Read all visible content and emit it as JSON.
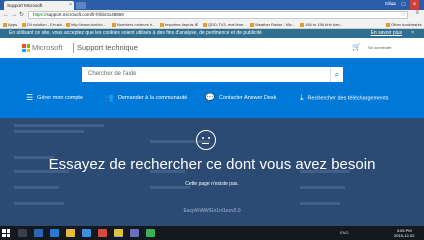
{
  "browser": {
    "tab_title": "Support Microsoft",
    "profile_name": "Gilles",
    "url_scheme": "https://",
    "url_host": "support.microsoft.com",
    "url_path": "/fr-fr/kb/3148869",
    "bookmarks": [
      "Apps",
      "Dll solution - Errusb...",
      "http://www.bonbio...",
      "Numbers moteurs h...",
      "Importes depuis IE",
      "QDD-TV3, real time...",
      "Weather Radar - Mic...",
      "156 to 158 kHz ban...",
      "Other bookmarks"
    ]
  },
  "cookie_banner": {
    "text": "En utilisant ce site, vous acceptez que les cookies soient utilisés à des fins d'analyse, de pertinence et de publicité",
    "link": "En savoir plus",
    "close": "×"
  },
  "header": {
    "brand": "Microsoft",
    "section": "Support technique",
    "signin": "Se connecter"
  },
  "hero": {
    "search_placeholder": "Chercher de l'aide",
    "quick_links": [
      {
        "icon": "list-icon",
        "glyph": "☰",
        "label": "Gérer mon compte"
      },
      {
        "icon": "community-icon",
        "glyph": "👥",
        "label": "Demander à la communauté"
      },
      {
        "icon": "chat-icon",
        "glyph": "💬",
        "label": "Contacter Answer Desk"
      },
      {
        "icon": "download-icon",
        "glyph": "⤓",
        "label": "Rechercher des téléchargements"
      }
    ]
  },
  "error": {
    "title": "Essayez de rechercher ce dont vous avez besoin",
    "subtitle": "Cette page n'existe pas.",
    "code": "EacpWiAWlGo1ni1ezv0.0"
  },
  "taskbar": {
    "lang": "ENG",
    "time": "3:55 PM",
    "date": "2015-12-02"
  },
  "colors": {
    "brand_blue": "#0078d7",
    "overlay": "#2b4b74",
    "cookie_bar": "#2f6f91"
  }
}
